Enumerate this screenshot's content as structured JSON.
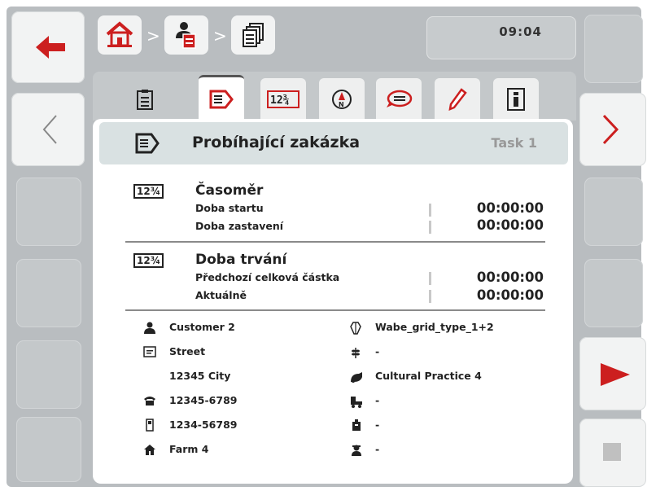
{
  "breadcrumb": {
    "home_icon": "home-icon",
    "separator": ">",
    "task_data_icon": "task-data-icon",
    "documents_icon": "documents-icon"
  },
  "clock": "09:04",
  "tabs": [
    {
      "name": "tab-list",
      "icon": "clipboard-icon"
    },
    {
      "name": "tab-current-task",
      "icon": "current-task-icon",
      "active": true
    },
    {
      "name": "tab-counters",
      "icon": "counter-icon"
    },
    {
      "name": "tab-navigation",
      "icon": "compass-icon"
    },
    {
      "name": "tab-comments",
      "icon": "speech-bubble-icon"
    },
    {
      "name": "tab-edit",
      "icon": "pencil-icon"
    },
    {
      "name": "tab-info",
      "icon": "info-icon"
    }
  ],
  "header": {
    "title": "Probíhající zakázka",
    "task_label": "Task 1"
  },
  "timer": {
    "icon_text": "12¾",
    "title": "Časoměr",
    "rows": [
      {
        "label": "Doba startu",
        "value": "00:00:00"
      },
      {
        "label": "Doba zastavení",
        "value": "00:00:00"
      }
    ]
  },
  "duration": {
    "icon_text": "12¾",
    "title": "Doba trvání",
    "rows": [
      {
        "label": "Předchozí celková částka",
        "value": "00:00:00"
      },
      {
        "label": "Aktuálně",
        "value": "00:00:00"
      }
    ]
  },
  "details_left": [
    {
      "icon": "customer-icon",
      "text": "Customer 2"
    },
    {
      "icon": "address-icon",
      "text": "Street"
    },
    {
      "icon": "",
      "text": "12345 City"
    },
    {
      "icon": "phone-icon",
      "text": "12345-6789"
    },
    {
      "icon": "mobile-icon",
      "text": "1234-56789"
    },
    {
      "icon": "farm-icon",
      "text": "Farm 4"
    }
  ],
  "details_right": [
    {
      "icon": "field-icon",
      "text": "Wabe_grid_type_1+2"
    },
    {
      "icon": "crop-icon",
      "text": "-"
    },
    {
      "icon": "cultural-practice-icon",
      "text": "Cultural Practice 4"
    },
    {
      "icon": "machine-icon",
      "text": "-"
    },
    {
      "icon": "product-icon",
      "text": "-"
    },
    {
      "icon": "worker-icon",
      "text": "-"
    }
  ],
  "side": {
    "back_icon": "back-arrow-icon",
    "prev_icon": "chevron-left-icon",
    "next_icon": "chevron-right-icon",
    "play_icon": "play-icon",
    "stop_icon": "stop-icon"
  },
  "colors": {
    "accent_red": "#cc1f1f",
    "frame": "#b9bdc0",
    "header_bg": "#d9e1e2"
  }
}
